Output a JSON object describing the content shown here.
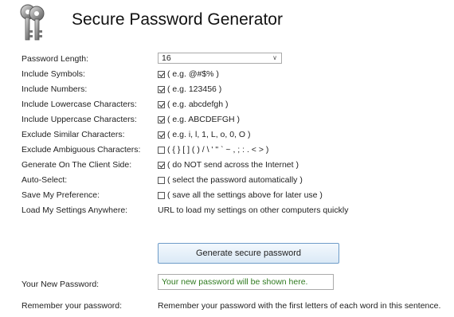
{
  "page": {
    "title": "Secure Password Generator"
  },
  "options": [
    {
      "label": "Password Length:",
      "type": "select",
      "value": "16"
    },
    {
      "label": "Include Symbols:",
      "type": "checkbox",
      "checked": true,
      "desc": "( e.g. @#$% )"
    },
    {
      "label": "Include Numbers:",
      "type": "checkbox",
      "checked": true,
      "desc": "( e.g. 123456 )"
    },
    {
      "label": "Include Lowercase Characters:",
      "type": "checkbox",
      "checked": true,
      "desc": "( e.g. abcdefgh )"
    },
    {
      "label": "Include Uppercase Characters:",
      "type": "checkbox",
      "checked": true,
      "desc": "( e.g. ABCDEFGH )"
    },
    {
      "label": "Exclude Similar Characters:",
      "type": "checkbox",
      "checked": true,
      "desc": "( e.g. i, l, 1, L, o, 0, O )"
    },
    {
      "label": "Exclude Ambiguous Characters:",
      "type": "checkbox",
      "checked": false,
      "desc": "( { } [ ] ( ) / \\ ' \" ` ~ , ; : . < > )"
    },
    {
      "label": "Generate On The Client Side:",
      "type": "checkbox",
      "checked": true,
      "desc": "( do NOT send across the Internet )"
    },
    {
      "label": "Auto-Select:",
      "type": "checkbox",
      "checked": false,
      "desc": "( select the password automatically )"
    },
    {
      "label": "Save My Preference:",
      "type": "checkbox",
      "checked": false,
      "desc": "( save all the settings above for later use )"
    },
    {
      "label": "Load My Settings Anywhere:",
      "type": "text",
      "desc": "URL to load my settings on other computers quickly"
    }
  ],
  "generate_button": "Generate secure password",
  "new_password": {
    "label": "Your New Password:",
    "placeholder": "Your new password will be shown here."
  },
  "remember": {
    "label": "Remember your password:",
    "text": "Remember your password with the first letters of each word in this sentence."
  }
}
